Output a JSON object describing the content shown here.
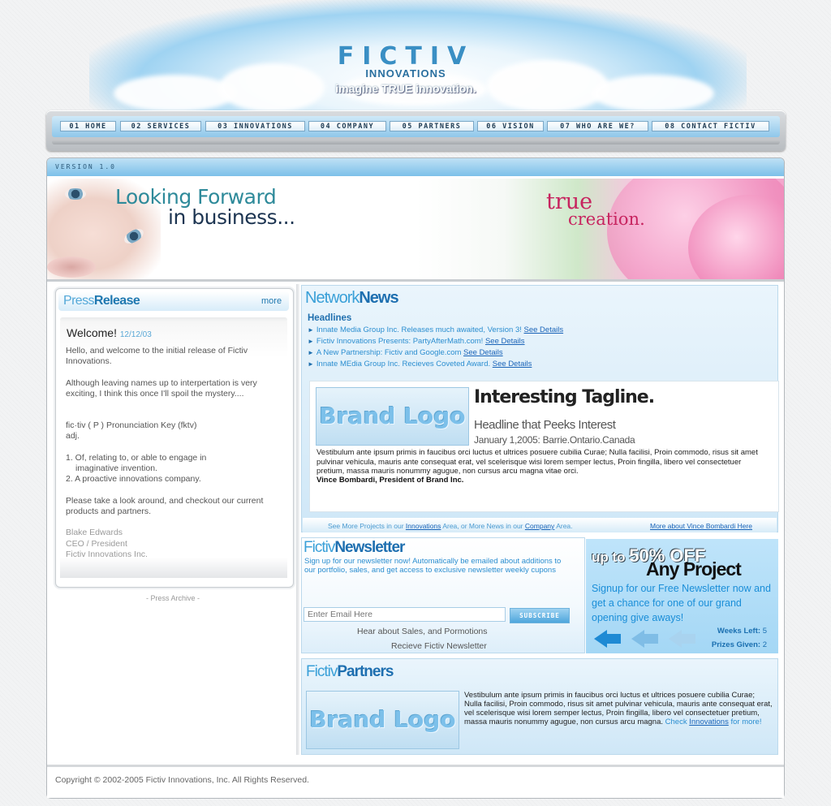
{
  "header": {
    "brand": "FICTIV",
    "subtitle": "INNOVATIONS",
    "tagline": "imagine TRUE innovation."
  },
  "nav": {
    "items": [
      {
        "label": "01 HOME"
      },
      {
        "label": "02 SERVICES"
      },
      {
        "label": "03 INNOVATIONS"
      },
      {
        "label": "04 COMPANY"
      },
      {
        "label": "05 PARTNERS"
      },
      {
        "label": "06 VISION"
      },
      {
        "label": "07 WHO ARE WE?"
      },
      {
        "label": "08 CONTACT FICTIV"
      }
    ]
  },
  "version": "VERSION 1.0",
  "banner": {
    "line1": "Looking Forward",
    "line2": "in business...",
    "true": "true",
    "creation": "creation."
  },
  "press": {
    "title_a": "Press",
    "title_b": "Release",
    "more": "more",
    "welcome": "Welcome!",
    "date": "12/12/03",
    "p1": "Hello, and welcome to the initial release of Fictiv Innovations.",
    "p2": "Although leaving names up to interpertation is very exciting, I think this once I'll spoil the mystery....",
    "p3a": "fic·tiv   ( P ) Pronunciation Key  (fktv)",
    "p3b": "adj.",
    "p4a": "1. Of, relating to, or able to engage in",
    "p4b": "imaginative invention.",
    "p4c": "2. A proactive innovations company.",
    "p5": "Please take a look around, and checkout our current products and partners.",
    "sig1": "Blake Edwards",
    "sig2": "CEO / President",
    "sig3": "Fictiv Innovations Inc.",
    "archive": "- Press Archive -"
  },
  "network": {
    "title_a": "Network",
    "title_b": "News",
    "headlines_label": "Headlines",
    "items": [
      {
        "text": "Innate Media Group Inc. Releases much awaited, Version 3!",
        "link": "See Details"
      },
      {
        "text": "Fictiv Innovations Presents: PartyAfterMath.com!",
        "link": "See Details"
      },
      {
        "text": "A New Partnership: Fictiv and Google.com",
        "link": "See Details"
      },
      {
        "text": "Innate MEdia Group Inc. Recieves Coveted Award.",
        "link": "See Details"
      }
    ]
  },
  "feature": {
    "logo": "Brand Logo",
    "tagline": "Interesting Tagline.",
    "headline": "Headline that Peeks Interest",
    "dateline": "January 1,2005:  Barrie.Ontario.Canada",
    "body": "Vestibulum ante ipsum primis in faucibus orci luctus et ultrices posuere cubilia Curae; Nulla facilisi, Proin commodo, risus sit amet pulvinar vehicula, mauris ante consequat erat, vel scelerisque wisi lorem semper lectus, Proin fingilla, libero vel consectetuer pretium, massa mauris nonummy agugue, non cursus arcu magna vitae orci.",
    "author": "Vince Bombardi, President of Brand Inc.",
    "foot_pre": "See More Projects in our",
    "foot_link1": "Innovations",
    "foot_mid": "Area, or More News in our",
    "foot_link2": "Company",
    "foot_post": "Area.",
    "foot_more": "More about Vince Bombardi Here"
  },
  "newsletter": {
    "title_a": "Fictiv",
    "title_b": "Newsletter",
    "text": "Sign up for our newsletter now! Automatically be emailed about additions to our portfolio, sales, and get access to exclusive newsletter weekly cupons",
    "email_placeholder": "Enter Email Here",
    "subscribe": "SUBSCRIBE",
    "hear": "Hear about Sales, and Pormotions",
    "receive": "Recieve Fictiv Newsletter"
  },
  "promo": {
    "upto": "up to",
    "percent": "50% OFF",
    "any": "Any Project",
    "signup": "Signup for our Free Newsletter now and get a chance for one of our grand opening give aways!",
    "weeks_label": "Weeks Left:",
    "weeks_value": "5",
    "prizes_label": "Prizes Given:",
    "prizes_value": "2"
  },
  "partners": {
    "title_a": "Fictiv",
    "title_b": "Partners",
    "logo": "Brand Logo",
    "body": "Vestibulum ante ipsum primis in faucibus orci luctus et ultrices posuere cubilia Curae; Nulla facilisi, Proin commodo, risus sit amet pulvinar vehicula, mauris ante consequat erat, vel scelerisque wisi lorem semper lectus, Proin fingilla, libero vel consectetuer pretium, massa mauris nonummy agugue, non cursus arcu magna.",
    "check": "Check",
    "check_link": "Innovations",
    "check_post": "for more!"
  },
  "footer": {
    "copyright": "Copyright © 2002-2005 Fictiv Innovations, Inc. All Rights Reserved."
  },
  "colors": {
    "accent": "#1e6fb0",
    "link": "#1a64b8",
    "pink": "#c7245f",
    "sky": "#8fc7ea"
  }
}
